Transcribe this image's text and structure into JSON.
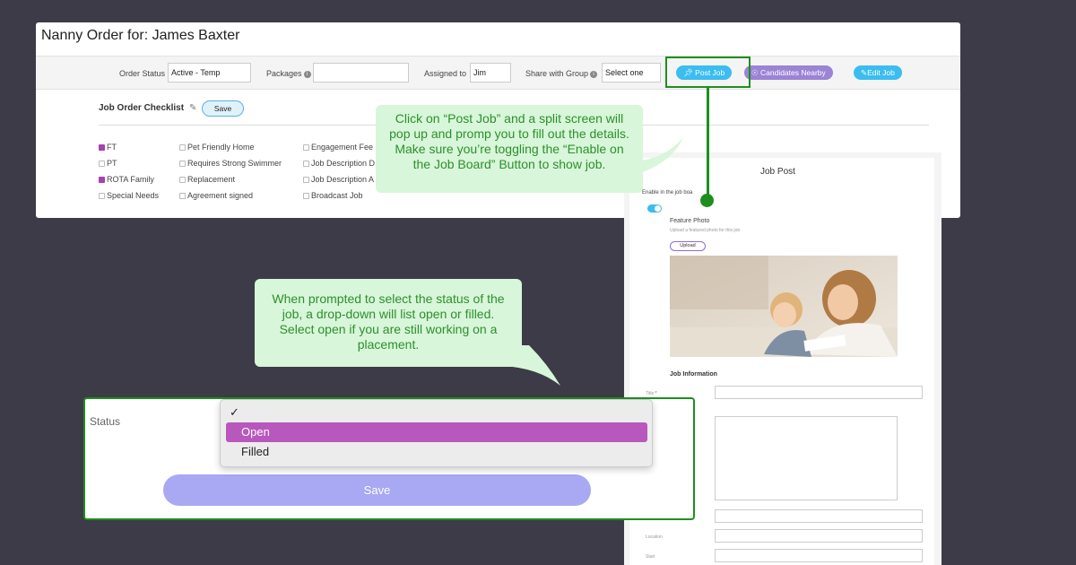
{
  "order": {
    "title": "Nanny Order for: James Baxter",
    "toolbar": {
      "order_status_label": "Order Status",
      "order_status_value": "Active - Temp",
      "packages_label": "Packages",
      "packages_value": "",
      "assigned_label": "Assigned to",
      "assigned_value": "Jim",
      "share_label": "Share with Group",
      "share_value": "Select one",
      "post_job": "Post Job",
      "candidates_nearby": "Candidates Nearby",
      "edit_job": "Edit Job"
    },
    "checklist": {
      "title": "Job Order Checklist",
      "save": "Save",
      "items": [
        {
          "label": "FT",
          "checked": true
        },
        {
          "label": "PT",
          "checked": false
        },
        {
          "label": "ROTA Family",
          "checked": true
        },
        {
          "label": "Special Needs",
          "checked": false
        },
        {
          "label": "Pet Friendly Home",
          "checked": false
        },
        {
          "label": "Requires Strong Swimmer",
          "checked": false
        },
        {
          "label": "Replacement",
          "checked": false
        },
        {
          "label": "Agreement signed",
          "checked": false
        },
        {
          "label": "Engagement Fee",
          "checked": false
        },
        {
          "label": "Job Description D",
          "checked": false
        },
        {
          "label": "Job Description A",
          "checked": false
        },
        {
          "label": "Broadcast Job",
          "checked": false
        }
      ]
    }
  },
  "callouts": {
    "post_job_tip": "Click on “Post Job” and a split screen will pop up and promp you to fill out the details. Make sure you’re toggling the “Enable on the Job Board” Button to show job.",
    "status_tip": "When prompted to select the status of the job, a drop-down will list open or filled. Select open if you are still working on a placement."
  },
  "job_post": {
    "title": "Job Post",
    "enable_label": "Enable in the job boa",
    "feature_photo": "Feature Photo",
    "feature_hint": "Upload a featured photo for this job",
    "upload": "Upload",
    "job_information": "Job Information",
    "title_label": "Title",
    "required_mark": "*",
    "location_label": "Location",
    "start_label": "Start"
  },
  "status_popup": {
    "label": "Status",
    "check_glyph": "✓",
    "options": [
      "Open",
      "Filled"
    ],
    "selected": "Open",
    "save": "Save"
  },
  "colors": {
    "accent_blue": "#3bbdf0",
    "accent_purple": "#9b83d6",
    "highlight_green": "#1e8f1e",
    "callout_bg": "#d8f6d9",
    "selected_option": "#b858bd",
    "save_button": "#a8a8f3"
  }
}
